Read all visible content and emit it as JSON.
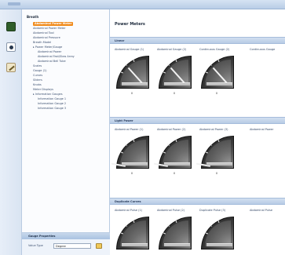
{
  "window": {
    "title": ""
  },
  "tree": {
    "root": "Breath",
    "items": [
      {
        "label": "Abdominal Power Meter",
        "selected": true
      },
      {
        "label": "Abdominal Power Meter",
        "selected": false
      },
      {
        "label": "Abdominal Tool",
        "selected": false
      },
      {
        "label": "Abdominal Pressure",
        "selected": false
      },
      {
        "label": "Breath Model",
        "selected": false
      },
      {
        "label": "▸ Power Meter/Gauge",
        "selected": false
      },
      {
        "label": "Abdominal Power",
        "selected": false
      },
      {
        "label": "Abdominal Fast/Slow Array",
        "selected": false
      },
      {
        "label": "Abdominal Bell Tube",
        "selected": false
      },
      {
        "label": "Scales",
        "selected": false
      },
      {
        "label": "Gauge (1)",
        "selected": false
      },
      {
        "label": "Curves",
        "selected": false
      },
      {
        "label": "Sliders",
        "selected": false
      },
      {
        "label": "Knobs",
        "selected": false
      },
      {
        "label": "Meter Displays",
        "selected": false
      },
      {
        "label": "▸ Information Gauges",
        "selected": false
      },
      {
        "label": "Information Gauge 1",
        "selected": false
      },
      {
        "label": "Information Gauge 2",
        "selected": false
      },
      {
        "label": "Information Gauge 3",
        "selected": false
      }
    ]
  },
  "bottom_panel": {
    "header": "Gauge Properties",
    "label": "Value Type",
    "value": "Degree"
  },
  "main": {
    "title": "Power Meters",
    "sections": [
      {
        "header": "Linear",
        "gauges": [
          {
            "title": "Abdominal Gauge (1)",
            "value": "0"
          },
          {
            "title": "Abdominal Gauge (2)",
            "value": "0"
          },
          {
            "title": "Continuous Gauge (2)",
            "value": "0"
          },
          {
            "title": "Continuous Gauge",
            "value": ""
          }
        ]
      },
      {
        "header": "Light Power",
        "gauges": [
          {
            "title": "Abdominal Power (1)",
            "value": "0"
          },
          {
            "title": "Abdominal Power (2)",
            "value": "0"
          },
          {
            "title": "Abdominal Power (3)",
            "value": "0"
          },
          {
            "title": "Abdominal Power",
            "value": ""
          }
        ]
      },
      {
        "header": "Duplicate Curves",
        "gauges": [
          {
            "title": "Abdominal Pulse (1)",
            "value": ""
          },
          {
            "title": "Abdominal Pulse (2)",
            "value": ""
          },
          {
            "title": "Duplicate Pulse (3)",
            "value": ""
          },
          {
            "title": "Abdominal Pulse",
            "value": ""
          }
        ]
      }
    ]
  },
  "icons": {
    "iconbar": [
      "breath-module-icon",
      "gauge-module-icon",
      "tools-module-icon"
    ]
  },
  "colors": {
    "accent": "#f08c1e",
    "header": "#b7cbe5"
  }
}
